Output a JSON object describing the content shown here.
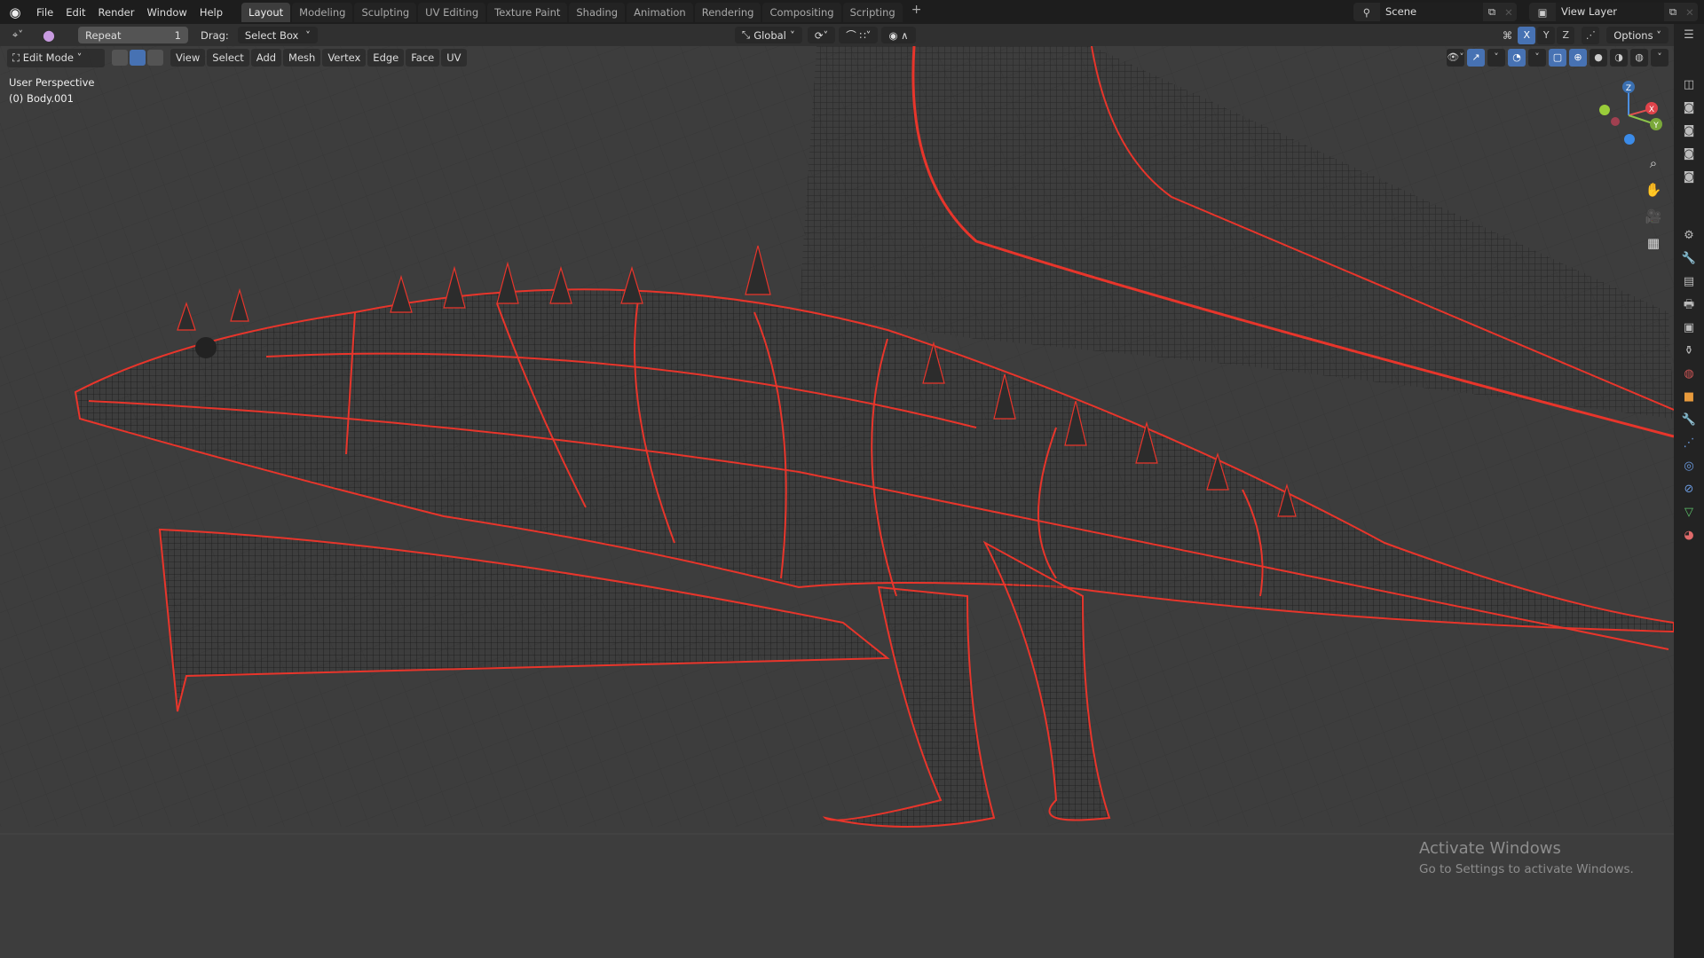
{
  "topbar": {
    "menu": [
      "File",
      "Edit",
      "Render",
      "Window",
      "Help"
    ],
    "tabs": [
      "Layout",
      "Modeling",
      "Sculpting",
      "UV Editing",
      "Texture Paint",
      "Shading",
      "Animation",
      "Rendering",
      "Compositing",
      "Scripting"
    ],
    "active_tab": "Layout",
    "add_tab": "+",
    "scene": "Scene",
    "view_layer": "View Layer"
  },
  "header": {
    "repeat_label": "Repeat",
    "repeat_count": "1",
    "drag_label": "Drag:",
    "drag_value": "Select Box",
    "orientation": "Global",
    "axes": [
      "X",
      "Y",
      "Z"
    ],
    "options": "Options"
  },
  "header2": {
    "mode": "Edit Mode",
    "menus": [
      "View",
      "Select",
      "Add",
      "Mesh",
      "Vertex",
      "Edge",
      "Face",
      "UV"
    ]
  },
  "viewport": {
    "perspective": "User Perspective",
    "object": "(0) Body.001",
    "gizmo_axes": [
      "X",
      "Y",
      "Z"
    ]
  },
  "watermark": {
    "title": "Activate Windows",
    "subtitle": "Go to Settings to activate Windows."
  },
  "colors": {
    "seam": "#e8352b",
    "accent": "#4772b3"
  }
}
